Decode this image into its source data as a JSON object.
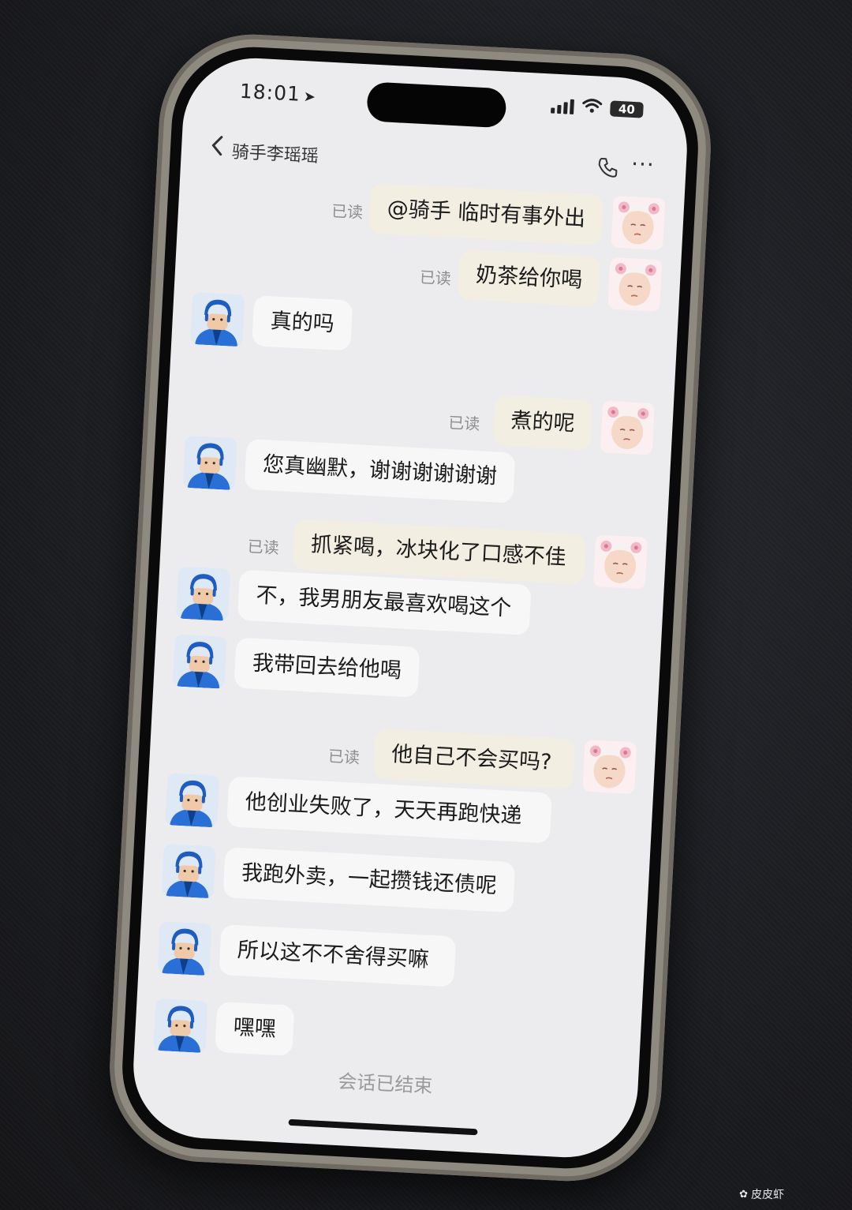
{
  "status_bar": {
    "time": "18:01",
    "battery": "40"
  },
  "header": {
    "title": "骑手李瑶瑶"
  },
  "read_receipt": "已读",
  "messages": [
    {
      "sender": "me",
      "text": "@骑手 临时有事外出",
      "read": "已读"
    },
    {
      "sender": "me",
      "text": "奶茶给你喝",
      "read": "已读"
    },
    {
      "sender": "rider",
      "text": "真的吗"
    },
    {
      "sender": "me",
      "text": "煮的呢",
      "read": "已读"
    },
    {
      "sender": "rider",
      "text": "您真幽默，谢谢谢谢谢谢"
    },
    {
      "sender": "me",
      "text": "抓紧喝，冰块化了口感不佳",
      "read": "已读"
    },
    {
      "sender": "rider",
      "text": "不，我男朋友最喜欢喝这个"
    },
    {
      "sender": "rider",
      "text": "我带回去给他喝"
    },
    {
      "sender": "me",
      "text": "他自己不会买吗?",
      "read": "已读"
    },
    {
      "sender": "rider",
      "text": "他创业失败了，天天再跑快递"
    },
    {
      "sender": "rider",
      "text": "我跑外卖，一起攒钱还债呢"
    },
    {
      "sender": "rider",
      "text": "所以这不不舍得买嘛"
    },
    {
      "sender": "rider",
      "text": "嘿嘿"
    }
  ],
  "footer": {
    "session_ended": "会话已结束"
  },
  "watermark": {
    "text": "皮皮虾"
  },
  "colors": {
    "my_bubble": "#f3eee2",
    "their_bubble": "#f7f7f8",
    "screen_bg": "#ecebed",
    "rider_avatar_blue": "#2a6fd6",
    "customer_avatar_pink": "#f2b8c8"
  },
  "icons": {
    "back": "chevron-left-icon",
    "call": "phone-icon",
    "more": "ellipsis-icon",
    "location": "location-arrow-icon"
  }
}
